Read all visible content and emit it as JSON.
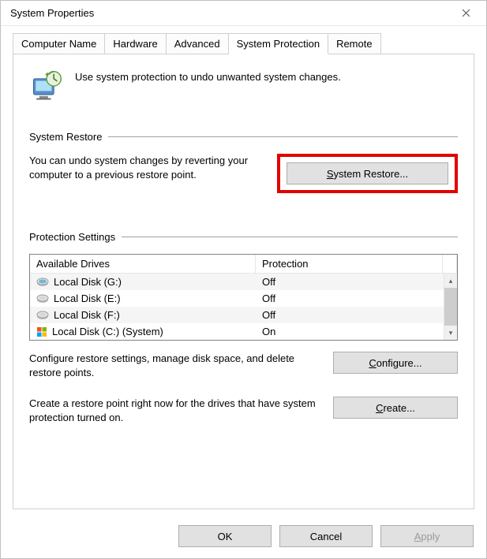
{
  "window": {
    "title": "System Properties"
  },
  "tabs": [
    {
      "label": "Computer Name"
    },
    {
      "label": "Hardware"
    },
    {
      "label": "Advanced"
    },
    {
      "label": "System Protection"
    },
    {
      "label": "Remote"
    }
  ],
  "intro": {
    "text": "Use system protection to undo unwanted system changes."
  },
  "restore": {
    "heading": "System Restore",
    "text": "You can undo system changes by reverting your computer to a previous restore point.",
    "button_prefix": "S",
    "button_suffix": "ystem Restore..."
  },
  "protection": {
    "heading": "Protection Settings",
    "columns": {
      "name": "Available Drives",
      "status": "Protection"
    },
    "drives": [
      {
        "label": "Local Disk (G:)",
        "status": "Off",
        "icon": "disk"
      },
      {
        "label": "Local Disk (E:)",
        "status": "Off",
        "icon": "disk"
      },
      {
        "label": "Local Disk (F:)",
        "status": "Off",
        "icon": "disk"
      },
      {
        "label": "Local Disk (C:) (System)",
        "status": "On",
        "icon": "win"
      }
    ],
    "configure_text": "Configure restore settings, manage disk space, and delete restore points.",
    "configure_prefix": "C",
    "configure_suffix": "onfigure...",
    "create_text": "Create a restore point right now for the drives that have system protection turned on.",
    "create_prefix": "C",
    "create_suffix": "reate..."
  },
  "buttons": {
    "ok": "OK",
    "cancel": "Cancel",
    "apply_prefix": "A",
    "apply_suffix": "pply"
  }
}
